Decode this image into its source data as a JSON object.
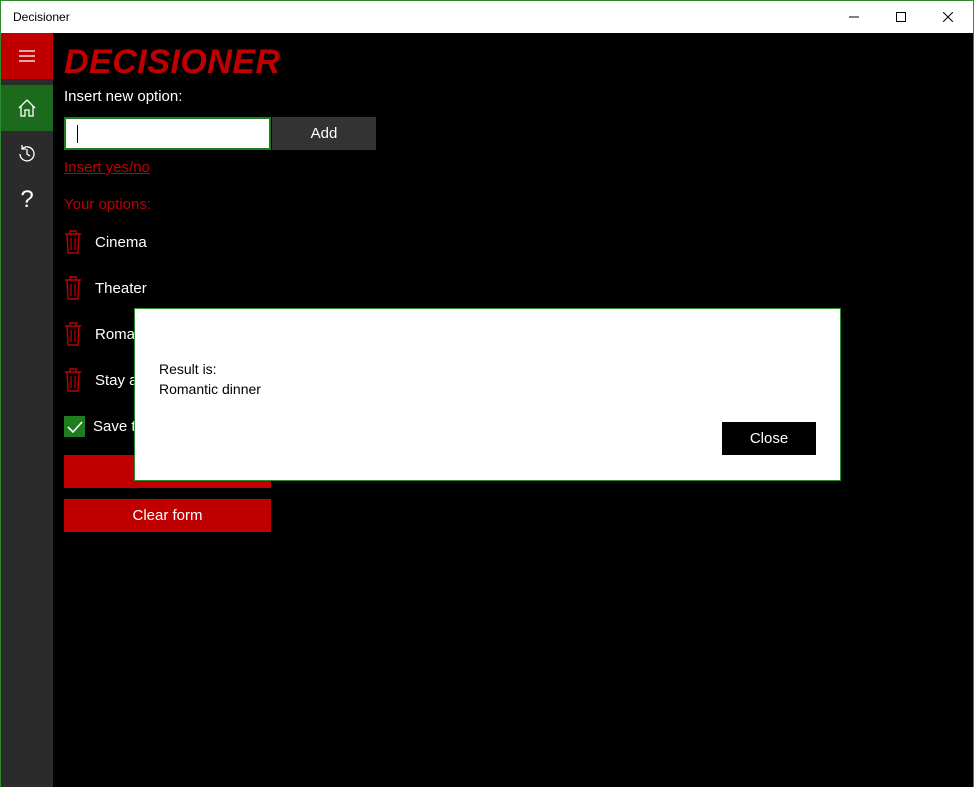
{
  "window": {
    "title": "Decisioner",
    "controls": {
      "minimize": "—",
      "maximize": "☐",
      "close": "✕"
    }
  },
  "sidebar": {
    "items": [
      {
        "name": "menu",
        "icon": "hamburger-icon"
      },
      {
        "name": "home",
        "icon": "home-icon"
      },
      {
        "name": "history",
        "icon": "history-icon"
      },
      {
        "name": "help",
        "icon": "help-icon",
        "glyph": "?"
      }
    ]
  },
  "main": {
    "logo": "DECISIONER",
    "insert_label": "Insert new option:",
    "input_value": "",
    "add_label": "Add",
    "yesno_link": "Insert yes/no",
    "options_label": "Your options:",
    "options": [
      "Cinema",
      "Theater",
      "Roma",
      "Stay a"
    ],
    "save_label": "Save t",
    "save_checked": true,
    "decide_label": "",
    "clear_label": "Clear form"
  },
  "dialog": {
    "line1": "Result is:",
    "line2": "Romantic dinner",
    "close_label": "Close"
  },
  "colors": {
    "accent_red": "#c00000",
    "accent_green": "#1e7d1e",
    "background": "#000000",
    "sidebar": "#2b2b2b"
  }
}
